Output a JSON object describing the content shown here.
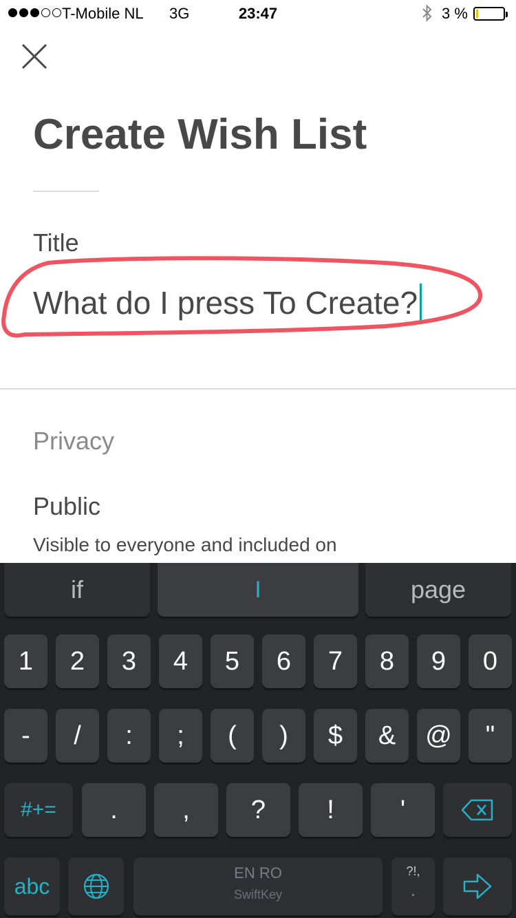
{
  "status_bar": {
    "carrier": "T-Mobile NL",
    "network": "3G",
    "time": "23:47",
    "battery_percent": "3 %",
    "signal_bars_filled": 3,
    "signal_bars_total": 5,
    "bluetooth_icon": "bluetooth-icon"
  },
  "header": {
    "close_icon": "close-icon",
    "title": "Create Wish List"
  },
  "form": {
    "title_label": "Title",
    "title_value": "What do I press To Create?",
    "privacy_label": "Privacy",
    "public_label": "Public",
    "public_description": "Visible to everyone and included on"
  },
  "annotation": {
    "color": "#ee5560"
  },
  "keyboard": {
    "suggestions": [
      "if",
      "I",
      "page"
    ],
    "row_numbers": [
      "1",
      "2",
      "3",
      "4",
      "5",
      "6",
      "7",
      "8",
      "9",
      "0"
    ],
    "row_symbols": [
      "-",
      "/",
      ":",
      ";",
      "(",
      ")",
      "$",
      "&",
      "@",
      "\""
    ],
    "row_third": {
      "shift_label": "#+=",
      "keys": [
        ".",
        ",",
        "?",
        "!",
        "'"
      ],
      "backspace_icon": "backspace-icon"
    },
    "row_bottom": {
      "abc_label": "abc",
      "globe_icon": "globe-icon",
      "space_language": "EN RO",
      "space_brand": "SwiftKey",
      "punct_top": "?!,",
      "punct_bottom": ".",
      "enter_icon": "arrow-right-icon"
    },
    "accent_color": "#24b3c6"
  }
}
